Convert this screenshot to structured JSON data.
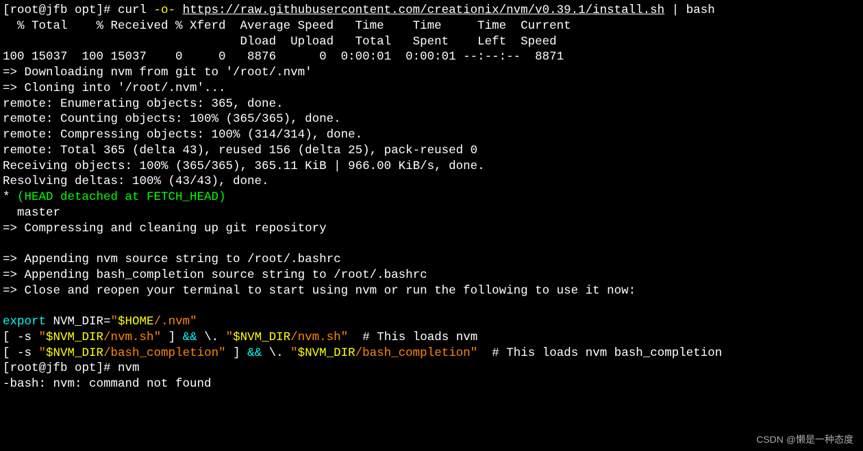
{
  "prompt1": {
    "user_host": "[root@jfb opt]# ",
    "cmd": "curl",
    "flag": " -o- ",
    "url": "https://raw.githubusercontent.com/creationix/nvm/v0.39.1/install.sh",
    "pipe": " | bash"
  },
  "curl_header": "  % Total    % Received % Xferd  Average Speed   Time    Time     Time  Current",
  "curl_header2": "                                 Dload  Upload   Total   Spent    Left  Speed",
  "curl_stats": "100 15037  100 15037    0     0   8876      0  0:00:01  0:00:01 --:--:--  8871",
  "download_msg": "=> Downloading nvm from git to '/root/.nvm'",
  "cloning_msg": "=> Cloning into '/root/.nvm'...",
  "remote1": "remote: Enumerating objects: 365, done.",
  "remote2": "remote: Counting objects: 100% (365/365), done.",
  "remote3": "remote: Compressing objects: 100% (314/314), done.",
  "remote4": "remote: Total 365 (delta 43), reused 156 (delta 25), pack-reused 0",
  "receiving": "Receiving objects: 100% (365/365), 365.11 KiB | 966.00 KiB/s, done.",
  "resolving": "Resolving deltas: 100% (43/43), done.",
  "head_star": "* ",
  "head_detached": "(HEAD detached at FETCH_HEAD)",
  "master": "  master",
  "compress_msg": "=> Compressing and cleaning up git repository",
  "blank": "",
  "append1": "=> Appending nvm source string to /root/.bashrc",
  "append2": "=> Appending bash_completion source string to /root/.bashrc",
  "close_msg": "=> Close and reopen your terminal to start using nvm or run the following to use it now:",
  "export_kw": "export",
  "export_rest1": " NVM_DIR=",
  "export_quote1": "\"",
  "export_var": "$HOME",
  "export_rest2": "/.nvm",
  "export_quote2": "\"",
  "line2_p1": "[ -s ",
  "line2_q1": "\"",
  "line2_var1": "$NVM_DIR",
  "line2_p2": "/nvm.sh",
  "line2_q2": "\"",
  "line2_p3": " ] ",
  "line2_and": "&&",
  "line2_p4": " \\. ",
  "line2_q3": "\"",
  "line2_var2": "$NVM_DIR",
  "line2_p5": "/nvm.sh",
  "line2_q4": "\"",
  "line2_comment": "  # This loads nvm",
  "line3_p1": "[ -s ",
  "line3_q1": "\"",
  "line3_var1": "$NVM_DIR",
  "line3_p2": "/bash_completion",
  "line3_q2": "\"",
  "line3_p3": " ] ",
  "line3_and": "&&",
  "line3_p4": " \\. ",
  "line3_q3": "\"",
  "line3_var2": "$NVM_DIR",
  "line3_p5": "/bash_completion",
  "line3_q4": "\"",
  "line3_comment": "  # This loads nvm bash_completion",
  "prompt2": {
    "user_host": "[root@jfb opt]# ",
    "cmd": "nvm"
  },
  "error_msg": "-bash: nvm: command not found",
  "watermark": "CSDN @懒是一种态度"
}
